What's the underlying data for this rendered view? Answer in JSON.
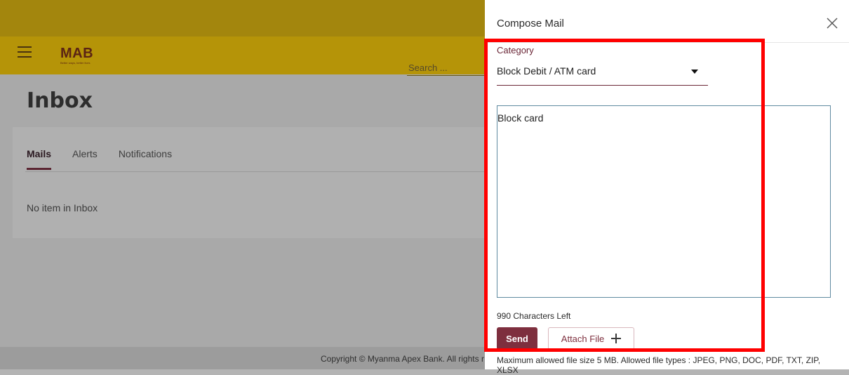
{
  "app": {
    "logo_text": "MAB",
    "logo_tagline": "Better ways, better lives",
    "search_placeholder": "Search ...",
    "page_title": "Inbox",
    "tabs": [
      {
        "label": "Mails",
        "active": true
      },
      {
        "label": "Alerts",
        "active": false
      },
      {
        "label": "Notifications",
        "active": false
      }
    ],
    "empty_message": "No item in Inbox",
    "copyright": "Copyright © Myanma Apex Bank. All rights r"
  },
  "compose": {
    "title": "Compose Mail",
    "category_label": "Category",
    "category_value": "Block Debit / ATM card",
    "message_value": "Block card",
    "chars_left": "990 Characters Left",
    "send_label": "Send",
    "attach_label": "Attach File",
    "file_note": "Maximum allowed file size 5 MB. Allowed file types : JPEG, PNG, DOC, PDF, TXT, ZIP, XLSX"
  },
  "colors": {
    "header": "#b59408",
    "brand_maroon": "#7e2f3e",
    "highlight": "#ff0000"
  },
  "icons": [
    "hamburger-icon",
    "close-icon",
    "caret-down-icon",
    "plus-icon"
  ]
}
